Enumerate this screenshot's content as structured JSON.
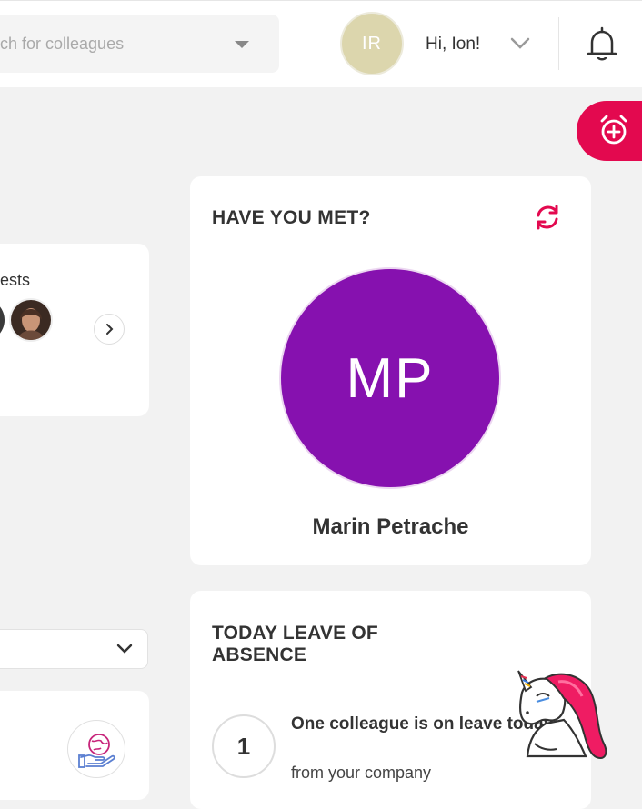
{
  "header": {
    "search_placeholder": "ch for colleagues",
    "user_initials": "IR",
    "greeting": "Hi, Ion!"
  },
  "guests_card": {
    "title_fragment": "ests"
  },
  "have_you_met": {
    "title": "HAVE YOU MET?",
    "initials": "MP",
    "name": "Marin Petrache"
  },
  "leave_card": {
    "title": "TODAY LEAVE OF ABSENCE",
    "count": "1",
    "message": "One colleague is on leave today.",
    "subtext": "from your company"
  },
  "colors": {
    "accent": "#e3094f",
    "met_avatar": "#8611af",
    "user_avatar": "#dcd6ad"
  },
  "icons": [
    "chevron-down-icon",
    "bell-icon",
    "alarm-add-icon",
    "chevron-right-icon",
    "refresh-icon",
    "globe-hand-icon",
    "unicorn-mascot"
  ]
}
